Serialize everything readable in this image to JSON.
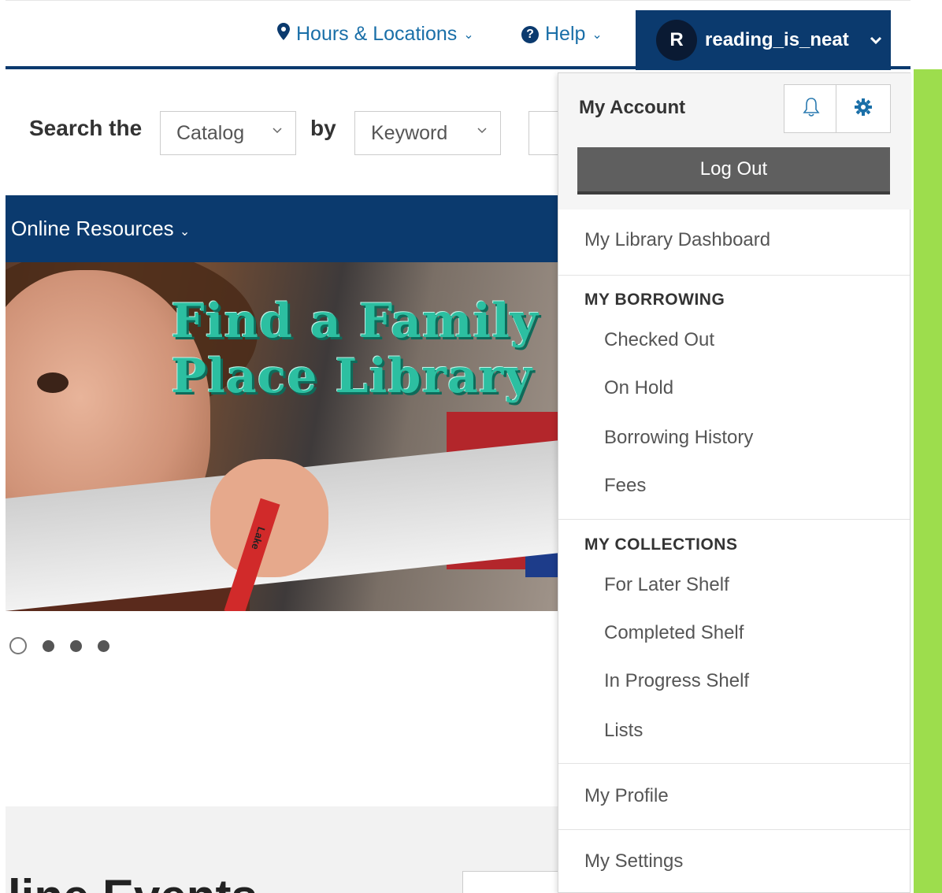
{
  "topbar": {
    "hours_label": "Hours & Locations",
    "help_label": "Help",
    "user_initial": "R",
    "username": "reading_is_neat"
  },
  "search": {
    "prefix": "Search the",
    "catalog_value": "Catalog",
    "by_label": "by",
    "type_value": "Keyword"
  },
  "nav": {
    "online_resources": "Online Resources"
  },
  "hero": {
    "title_line1": "Find a Family",
    "title_line2": "Place Library",
    "crayon_text": "Lake"
  },
  "carousel": {
    "slides": 4,
    "active": 1
  },
  "bottom": {
    "partial_heading": "line Events"
  },
  "menu": {
    "title": "My Account",
    "logout": "Log Out",
    "dashboard": "My Library Dashboard",
    "borrowing_section": "MY BORROWING",
    "checked_out": "Checked Out",
    "on_hold": "On Hold",
    "borrowing_history": "Borrowing History",
    "fees": "Fees",
    "collections_section": "MY COLLECTIONS",
    "for_later": "For Later Shelf",
    "completed": "Completed Shelf",
    "in_progress": "In Progress Shelf",
    "lists": "Lists",
    "profile": "My Profile",
    "settings": "My Settings"
  },
  "colors": {
    "navy": "#0b3a6e",
    "link_blue": "#1a6fa8",
    "accent_green": "#9ddd4d",
    "hero_teal": "#2cbfa1"
  }
}
